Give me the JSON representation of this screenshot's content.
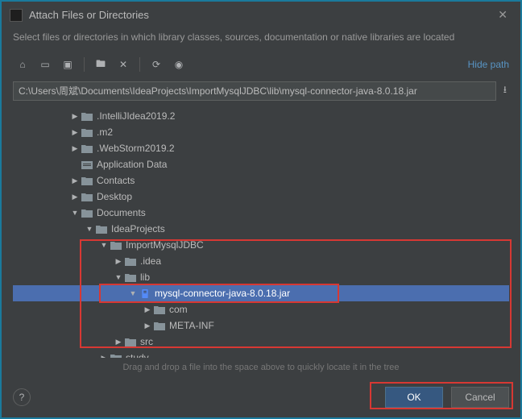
{
  "title": "Attach Files or Directories",
  "subtitle": "Select files or directories in which library classes, sources, documentation or native libraries are located",
  "hide_path": "Hide path",
  "path": "C:\\Users\\周斌\\Documents\\IdeaProjects\\ImportMysqlJDBC\\lib\\mysql-connector-java-8.0.18.jar",
  "hint": "Drag and drop a file into the space above to quickly locate it in the tree",
  "buttons": {
    "ok": "OK",
    "cancel": "Cancel"
  },
  "tree": [
    {
      "indent": 0,
      "arrow": "▶",
      "type": "folder",
      "label": ".IntelliJIdea2019.2"
    },
    {
      "indent": 0,
      "arrow": "▶",
      "type": "folder",
      "label": ".m2"
    },
    {
      "indent": 0,
      "arrow": "▶",
      "type": "folder",
      "label": ".WebStorm2019.2"
    },
    {
      "indent": 0,
      "arrow": "",
      "type": "appdata",
      "label": "Application Data"
    },
    {
      "indent": 0,
      "arrow": "▶",
      "type": "folder",
      "label": "Contacts"
    },
    {
      "indent": 0,
      "arrow": "▶",
      "type": "folder",
      "label": "Desktop"
    },
    {
      "indent": 0,
      "arrow": "▼",
      "type": "folder",
      "label": "Documents"
    },
    {
      "indent": 1,
      "arrow": "▼",
      "type": "folder",
      "label": "IdeaProjects"
    },
    {
      "indent": 2,
      "arrow": "▼",
      "type": "folder",
      "label": "ImportMysqlJDBC"
    },
    {
      "indent": 3,
      "arrow": "▶",
      "type": "folder",
      "label": ".idea"
    },
    {
      "indent": 3,
      "arrow": "▼",
      "type": "folder",
      "label": "lib"
    },
    {
      "indent": 4,
      "arrow": "▼",
      "type": "jar",
      "label": "mysql-connector-java-8.0.18.jar",
      "selected": true
    },
    {
      "indent": 5,
      "arrow": "▶",
      "type": "folder",
      "label": "com"
    },
    {
      "indent": 5,
      "arrow": "▶",
      "type": "folder",
      "label": "META-INF"
    },
    {
      "indent": 3,
      "arrow": "▶",
      "type": "folder",
      "label": "src"
    },
    {
      "indent": 2,
      "arrow": "▶",
      "type": "folder",
      "label": "study"
    }
  ]
}
